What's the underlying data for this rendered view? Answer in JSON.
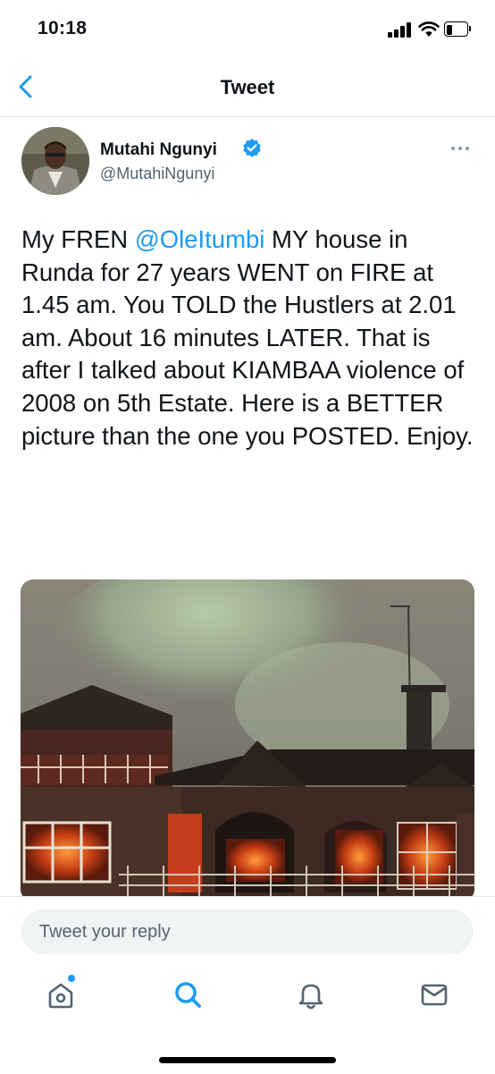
{
  "status_bar": {
    "time": "10:18"
  },
  "nav": {
    "title": "Tweet"
  },
  "author": {
    "name": "Mutahi Ngunyi",
    "handle": "@MutahiNgunyi"
  },
  "tweet": {
    "text_before_mention": "My FREN ",
    "mention": "@OleItumbi",
    "text_after_mention": " MY house in Runda for 27 years WENT on FIRE at 1.45 am. You TOLD the Hustlers at 2.01 am. About 16 minutes LATER. That is after I talked about KIAMBAA violence of 2008 on 5th Estate. Here is a BETTER picture than the one you POSTED. Enjoy."
  },
  "reply": {
    "placeholder": "Tweet your reply"
  },
  "tabbar": {
    "items": [
      "home-icon",
      "search-icon",
      "notifications-icon",
      "messages-icon"
    ],
    "active": "search-icon"
  },
  "colors": {
    "accent": "#1d9bf0",
    "text": "#0f1419",
    "secondary": "#536471",
    "input_bg": "#eff3f4"
  }
}
